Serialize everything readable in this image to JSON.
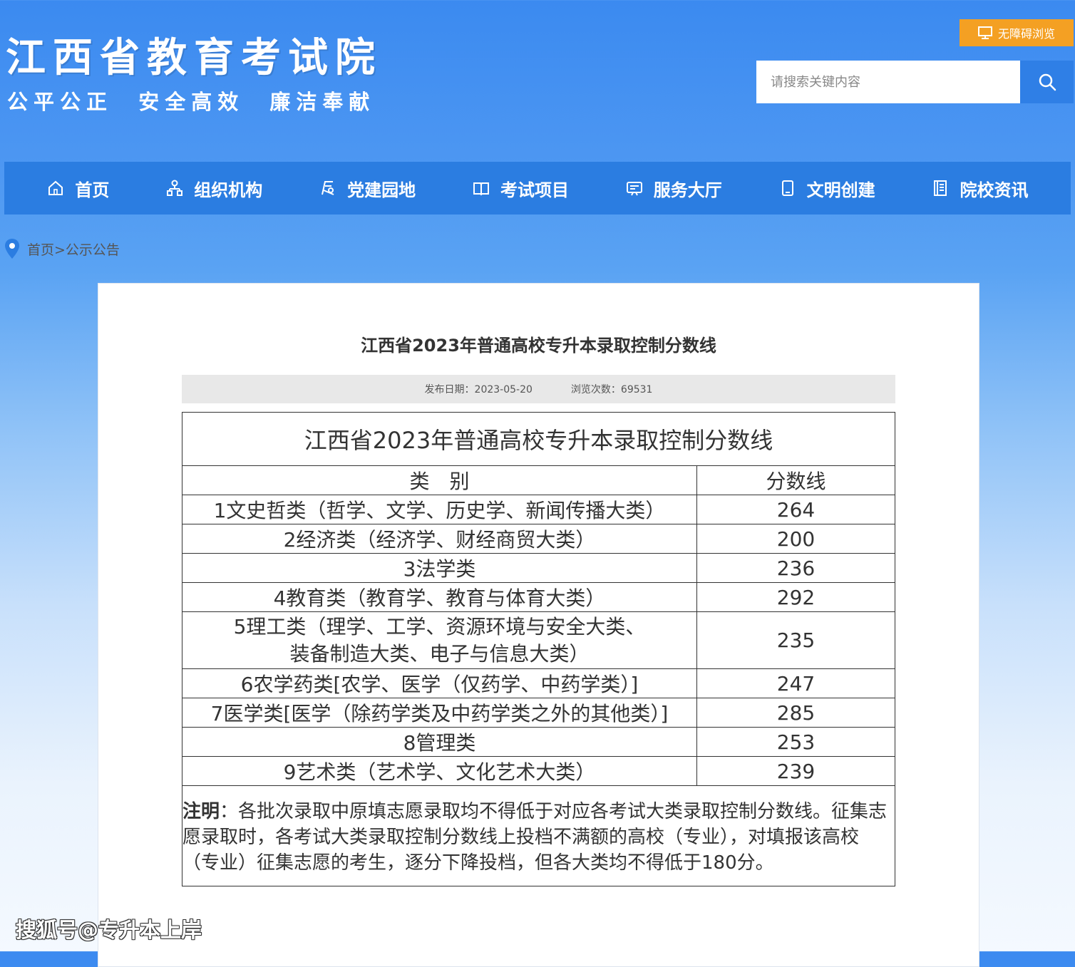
{
  "header": {
    "site_title": "江西省教育考试院",
    "slogan": "公平公正  安全高效  廉洁奉献",
    "accessibility_label": "无障碍浏览",
    "search_placeholder": "请搜索关键内容"
  },
  "nav": {
    "items": [
      {
        "label": "首页",
        "icon": "home-icon"
      },
      {
        "label": "组织机构",
        "icon": "org-chart-icon"
      },
      {
        "label": "党建园地",
        "icon": "party-icon"
      },
      {
        "label": "考试项目",
        "icon": "book-icon"
      },
      {
        "label": "服务大厅",
        "icon": "service-icon"
      },
      {
        "label": "文明创建",
        "icon": "tablet-icon"
      },
      {
        "label": "院校资讯",
        "icon": "news-icon"
      }
    ]
  },
  "breadcrumb": {
    "text": "首页>公示公告"
  },
  "article": {
    "title": "江西省2023年普通高校专升本录取控制分数线",
    "publish_label": "发布日期：",
    "publish_date": "2023-05-20",
    "views_label": "浏览次数：",
    "views_count": "69531"
  },
  "table": {
    "caption": "江西省2023年普通高校专升本录取控制分数线",
    "headers": [
      "类　别",
      "分数线"
    ],
    "rows": [
      {
        "category": "1文史哲类（哲学、文学、历史学、新闻传播大类）",
        "score": "264"
      },
      {
        "category": "2经济类（经济学、财经商贸大类）",
        "score": "200"
      },
      {
        "category": "3法学类",
        "score": "236"
      },
      {
        "category": "4教育类（教育学、教育与体育大类）",
        "score": "292"
      },
      {
        "category": "5理工类（理学、工学、资源环境与安全大类、",
        "category_line2": "装备制造大类、电子与信息大类）",
        "score": "235"
      },
      {
        "category": "6农学药类[农学、医学（仅药学、中药学类）]",
        "score": "247"
      },
      {
        "category": "7医学类[医学（除药学类及中药学类之外的其他类）]",
        "score": "285"
      },
      {
        "category": "8管理类",
        "score": "253"
      },
      {
        "category": "9艺术类（艺术学、文化艺术大类）",
        "score": "239"
      }
    ],
    "note_label": "注明",
    "note_text": "：各批次录取中原填志愿录取均不得低于对应各考试大类录取控制分数线。征集志愿录取时，各考试大类录取控制分数线上投档不满额的高校（专业），对填报该高校（专业）征集志愿的考生，逐分下降投档，但各大类均不得低于180分。"
  },
  "watermark": "搜狐号@专升本上岸"
}
